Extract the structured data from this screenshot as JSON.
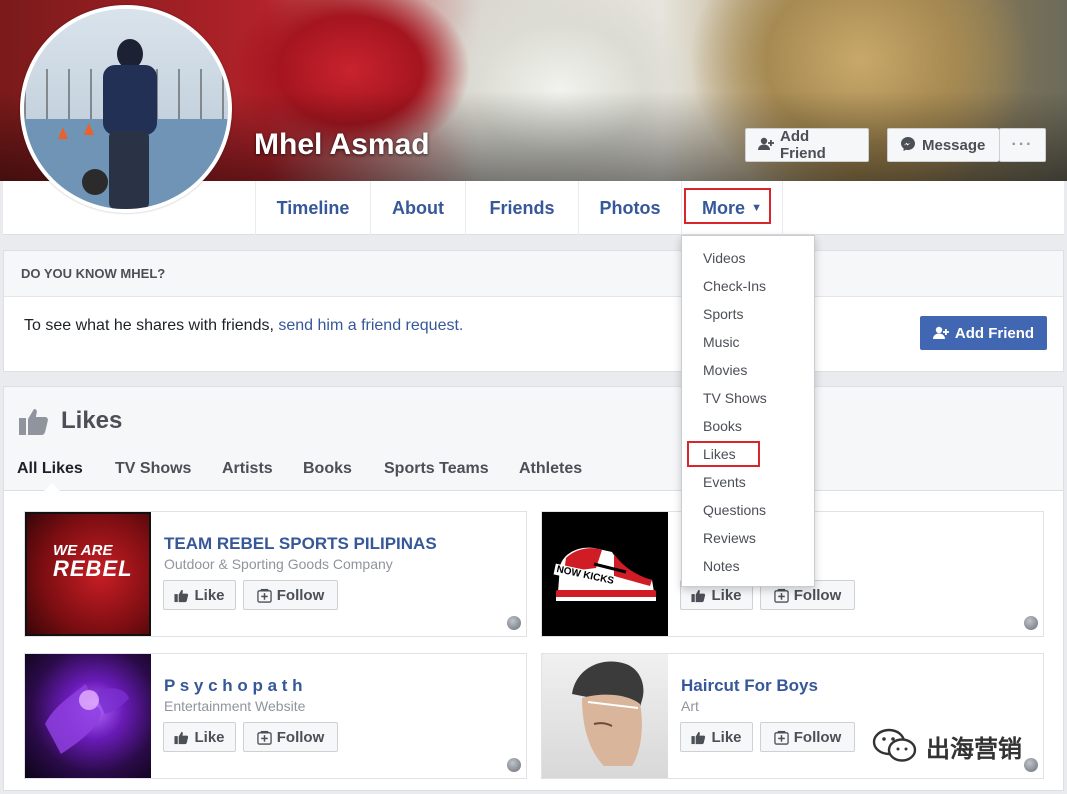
{
  "profile": {
    "name": "Mhel Asmad",
    "add_friend_label": "Add Friend",
    "message_label": "Message",
    "more_dots": "···"
  },
  "nav": {
    "tabs": [
      "Timeline",
      "About",
      "Friends",
      "Photos"
    ],
    "more_label": "More"
  },
  "more_menu": {
    "items": [
      "Videos",
      "Check-Ins",
      "Sports",
      "Music",
      "Movies",
      "TV Shows",
      "Books",
      "Likes",
      "Events",
      "Questions",
      "Reviews",
      "Notes"
    ],
    "highlighted": "Likes"
  },
  "know": {
    "heading": "DO YOU KNOW MHEL?",
    "text": "To see what he shares with friends, ",
    "link": "send him a friend request.",
    "button": "Add Friend"
  },
  "likes": {
    "title": "Likes",
    "tabs": [
      "All Likes",
      "TV Shows",
      "Artists",
      "Books",
      "Sports Teams",
      "Athletes"
    ],
    "active_tab": "All Likes",
    "like_label": "Like",
    "follow_label": "Follow",
    "cards": [
      {
        "name": "TEAM REBEL SPORTS PILIPINAS",
        "category": "Outdoor & Sporting Goods Company",
        "image_text_1": "WE ARE",
        "image_text_2": "REBEL"
      },
      {
        "name": "",
        "category": "",
        "image_text_1": "NOW KICKS"
      },
      {
        "name": "P s y c h o p a t h",
        "category": "Entertainment Website"
      },
      {
        "name": "Haircut For Boys",
        "category": "Art"
      }
    ]
  },
  "watermark": {
    "text": "出海营销"
  },
  "colors": {
    "link": "#365899",
    "highlight": "#d9262d",
    "primary": "#4267b2"
  }
}
